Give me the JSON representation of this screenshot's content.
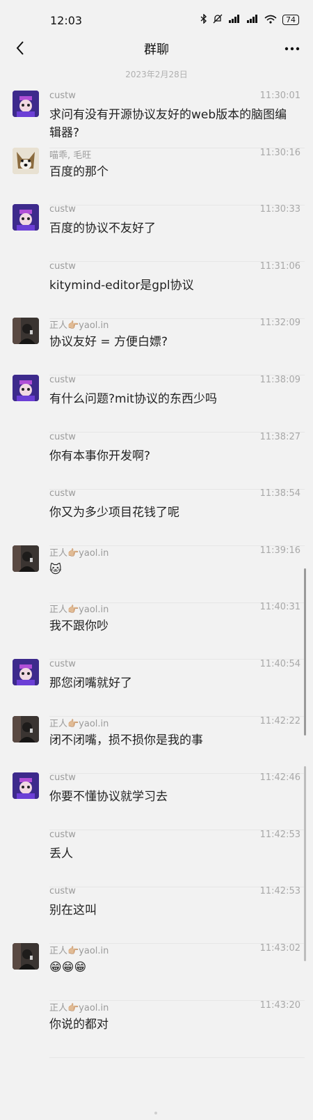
{
  "status": {
    "time": "12:03",
    "battery": "74",
    "icons": [
      "bluetooth-icon",
      "mute-icon",
      "signal-icon",
      "signal2-icon",
      "wifi-icon",
      "battery-icon"
    ]
  },
  "header": {
    "title": "群聊",
    "back_icon": "back-chevron-icon",
    "more_icon": "more-dots-icon"
  },
  "date_separator": "2023年2月28日",
  "messages": [
    {
      "name": "custw",
      "time": "11:30:01",
      "text": "求问有没有开源协议友好的web版本的脑图编辑器?",
      "avatar": "purple",
      "show_avatar": true
    },
    {
      "name": "喵乖, 毛旺",
      "time": "11:30:16",
      "text": "百度的那个",
      "avatar": "dog",
      "show_avatar": true
    },
    {
      "name": "custw",
      "time": "11:30:33",
      "text": "百度的协议不友好了",
      "avatar": "purple",
      "show_avatar": true
    },
    {
      "name": "custw",
      "time": "11:31:06",
      "text": "kitymind-editor是gpl协议",
      "avatar": "purple",
      "show_avatar": false
    },
    {
      "name": "正人👉🏼yaol.in",
      "time": "11:32:09",
      "text": "协议友好 = 方便白嫖?",
      "avatar": "dark",
      "show_avatar": true
    },
    {
      "name": "custw",
      "time": "11:38:09",
      "text": "有什么问题?mit协议的东西少吗",
      "avatar": "purple",
      "show_avatar": true
    },
    {
      "name": "custw",
      "time": "11:38:27",
      "text": "你有本事你开发啊?",
      "avatar": "purple",
      "show_avatar": false
    },
    {
      "name": "custw",
      "time": "11:38:54",
      "text": "你又为多少项目花钱了呢",
      "avatar": "purple",
      "show_avatar": false
    },
    {
      "name": "正人👉🏼yaol.in",
      "time": "11:39:16",
      "text": "🐱",
      "avatar": "dark",
      "show_avatar": true
    },
    {
      "name": "正人👉🏼yaol.in",
      "time": "11:40:31",
      "text": "我不跟你吵",
      "avatar": "dark",
      "show_avatar": false
    },
    {
      "name": "custw",
      "time": "11:40:54",
      "text": "那您闭嘴就好了",
      "avatar": "purple",
      "show_avatar": true
    },
    {
      "name": "正人👉🏼yaol.in",
      "time": "11:42:22",
      "text": "闭不闭嘴，损不损你是我的事",
      "avatar": "dark",
      "show_avatar": true
    },
    {
      "name": "custw",
      "time": "11:42:46",
      "text": "你要不懂协议就学习去",
      "avatar": "purple",
      "show_avatar": true
    },
    {
      "name": "custw",
      "time": "11:42:53",
      "text": "丢人",
      "avatar": "purple",
      "show_avatar": false
    },
    {
      "name": "custw",
      "time": "11:42:53",
      "text": "别在这叫",
      "avatar": "purple",
      "show_avatar": false
    },
    {
      "name": "正人👉🏼yaol.in",
      "time": "11:43:02",
      "text": "😁😁😁",
      "avatar": "dark",
      "show_avatar": true
    },
    {
      "name": "正人👉🏼yaol.in",
      "time": "11:43:20",
      "text": "你说的都对",
      "avatar": "dark",
      "show_avatar": false
    }
  ],
  "colors": {
    "background": "#f2f2f2",
    "meta_text": "#9a9a9a",
    "message_text": "#222222",
    "avatar_purple": "#3d2a8c"
  }
}
